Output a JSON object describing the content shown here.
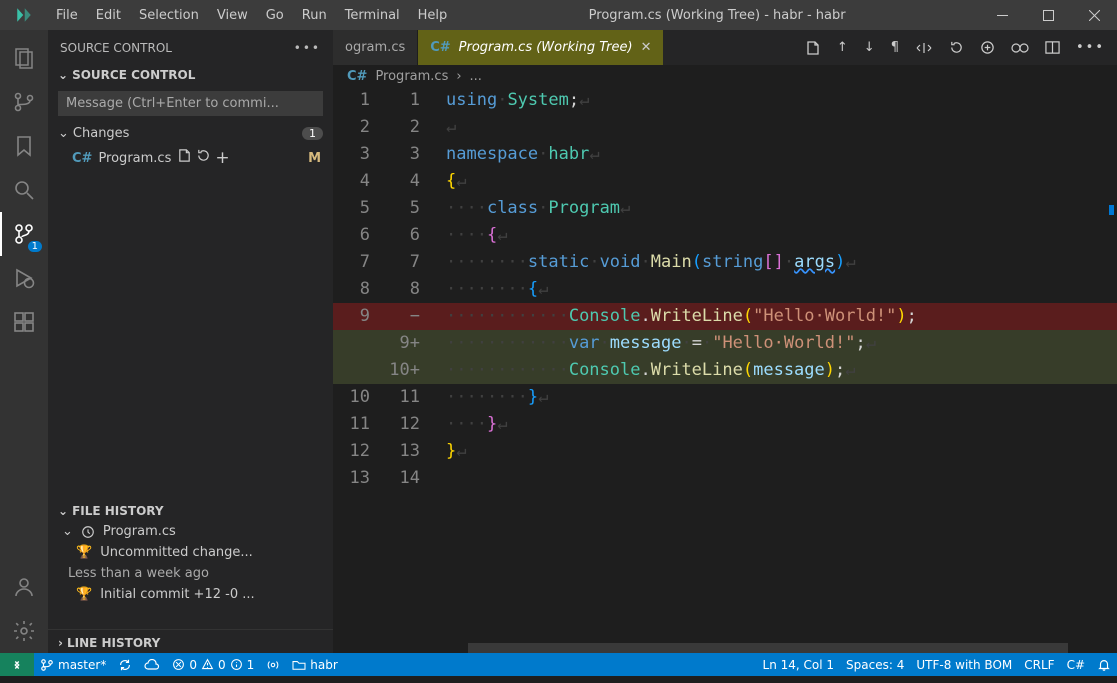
{
  "title": "Program.cs (Working Tree) - habr - habr",
  "menu": [
    "File",
    "Edit",
    "Selection",
    "View",
    "Go",
    "Run",
    "Terminal",
    "Help"
  ],
  "sidebar": {
    "title": "SOURCE CONTROL",
    "section": "SOURCE CONTROL",
    "commit_placeholder": "Message (Ctrl+Enter to commi...",
    "changes_label": "Changes",
    "changes_count": "1",
    "file": {
      "name": "Program.cs",
      "status": "M"
    },
    "file_history": "FILE HISTORY",
    "fh_file": "Program.cs",
    "fh_rows": [
      {
        "icon": "trophy",
        "label": "Uncommitted change..."
      },
      {
        "icon": "",
        "label": "Less than a week ago"
      },
      {
        "icon": "trophy",
        "label": "Initial commit  +12 -0  ..."
      }
    ],
    "line_history": "LINE HISTORY"
  },
  "tabs": {
    "prev": "ogram.cs",
    "active": "Program.cs (Working Tree)"
  },
  "breadcrumb": {
    "file": "Program.cs",
    "dots": "..."
  },
  "code": {
    "lines": [
      {
        "g1": "1",
        "g2": "1",
        "type": "norm",
        "html": "<span class='tok-key'>using</span><span class='ws'>·</span><span class='tok-type'>System</span><span class='tok-punc'>;</span><span class='eol'>↵</span>"
      },
      {
        "g1": "2",
        "g2": "2",
        "type": "norm",
        "html": "<span class='eol'>↵</span>"
      },
      {
        "g1": "3",
        "g2": "3",
        "type": "norm",
        "html": "<span class='tok-key'>namespace</span><span class='ws'>·</span><span class='tok-type'>habr</span><span class='eol'>↵</span>"
      },
      {
        "g1": "4",
        "g2": "4",
        "type": "norm",
        "html": "<span class='tok-br3'>{</span><span class='eol'>↵</span>"
      },
      {
        "g1": "5",
        "g2": "5",
        "type": "norm",
        "html": "<span class='ws'>····</span><span class='tok-key'>class</span><span class='ws'>·</span><span class='tok-type'>Program</span><span class='eol'>↵</span>"
      },
      {
        "g1": "6",
        "g2": "6",
        "type": "norm",
        "html": "<span class='ws'>····</span><span class='tok-br'>{</span><span class='eol'>↵</span>"
      },
      {
        "g1": "7",
        "g2": "7",
        "type": "norm",
        "html": "<span class='ws'>········</span><span class='tok-key'>static</span><span class='ws'>·</span><span class='tok-key'>void</span><span class='ws'>·</span><span class='tok-fn'>Main</span><span class='tok-br2'>(</span><span class='tok-key'>string</span><span class='tok-br'>[]</span><span class='ws'>·</span><span class='tok-param' style='text-decoration:underline wavy #3794ff'>args</span><span class='tok-br2'>)</span><span class='eol'>↵</span>"
      },
      {
        "g1": "8",
        "g2": "8",
        "type": "norm",
        "html": "<span class='ws'>········</span><span class='tok-br2'>{</span><span class='eol'>↵</span>"
      },
      {
        "g1": "9",
        "g2": "−",
        "type": "del",
        "html": "<span class='ws'>············</span><span class='tok-type'>Console</span><span class='tok-punc'>.</span><span class='tok-fn'>WriteLine</span><span class='tok-br3'>(</span><span class='tok-str'>\"Hello·World!\"</span><span class='tok-br3'>)</span><span class='tok-punc'>;</span>"
      },
      {
        "g1": "",
        "g2": "9+",
        "type": "add",
        "html": "<span class='ws'>············</span><span class='tok-key'>var</span><span class='ws'>·</span><span class='tok-param'>message</span><span class='ws'>·</span><span class='tok-punc'>=</span><span class='ws'>·</span><span class='tok-str'>\"Hello·World!\"</span><span class='tok-punc'>;</span><span class='eol'>↵</span>"
      },
      {
        "g1": "",
        "g2": "10+",
        "type": "add",
        "html": "<span class='ws'>············</span><span class='tok-type'>Console</span><span class='tok-punc'>.</span><span class='tok-fn'>WriteLine</span><span class='tok-br3'>(</span><span class='tok-param'>message</span><span class='tok-br3'>)</span><span class='tok-punc'>;</span><span class='eol'>↵</span>"
      },
      {
        "g1": "10",
        "g2": "11",
        "type": "norm",
        "html": "<span class='ws'>········</span><span class='tok-br2'>}</span><span class='eol'>↵</span>"
      },
      {
        "g1": "11",
        "g2": "12",
        "type": "norm",
        "html": "<span class='ws'>····</span><span class='tok-br'>}</span><span class='eol'>↵</span>"
      },
      {
        "g1": "12",
        "g2": "13",
        "type": "norm",
        "html": "<span class='tok-br3'>}</span><span class='eol'>↵</span>"
      },
      {
        "g1": "13",
        "g2": "14",
        "type": "norm",
        "html": ""
      }
    ]
  },
  "status": {
    "branch": "master*",
    "sync": "",
    "errors": "0",
    "warnings": "0",
    "info": "1",
    "folder": "habr",
    "pos": "Ln 14, Col 1",
    "spaces": "Spaces: 4",
    "encoding": "UTF-8 with BOM",
    "eol": "CRLF",
    "lang": "C#"
  }
}
